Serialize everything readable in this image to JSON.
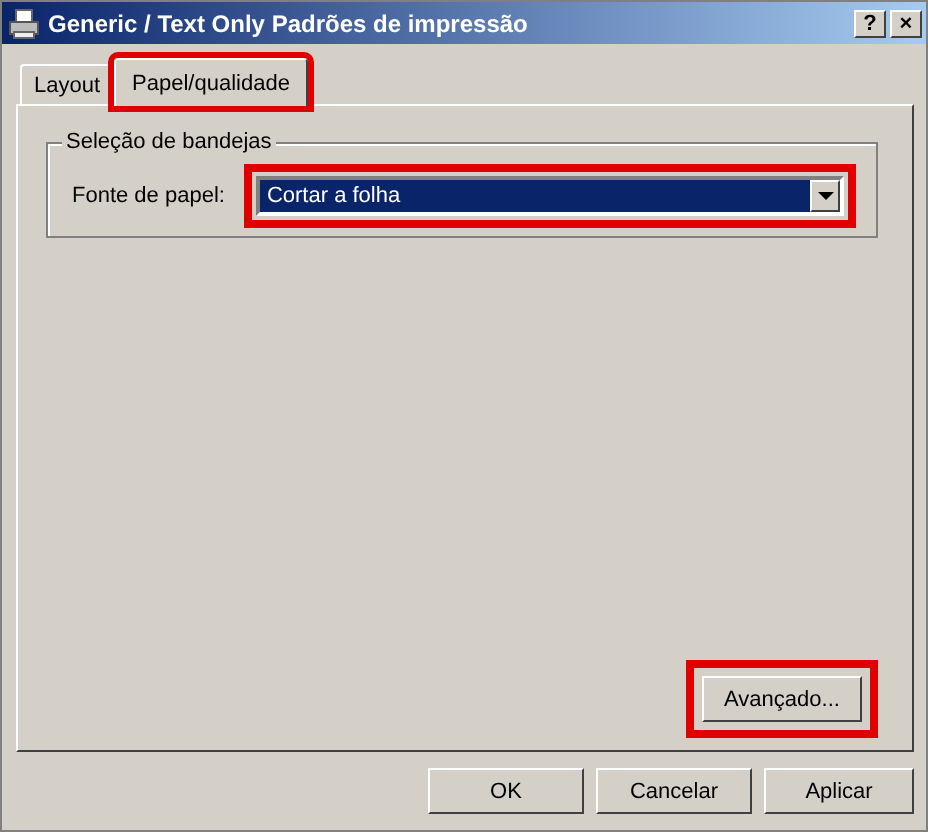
{
  "window": {
    "title": "Generic / Text Only Padrões de impressão",
    "title_buttons": [
      "?",
      "×"
    ]
  },
  "tabs": [
    {
      "label": "Layout",
      "selected": false,
      "highlighted": false
    },
    {
      "label": "Papel/qualidade",
      "selected": true,
      "highlighted": true
    }
  ],
  "group": {
    "title": "Seleção de bandejas",
    "field": {
      "label": "Fonte de papel:",
      "value": "Cortar a folha",
      "highlighted": true
    }
  },
  "advanced_button": {
    "label": "Avançado...",
    "highlighted": true
  },
  "buttons": [
    "OK",
    "Cancelar",
    "Aplicar"
  ]
}
